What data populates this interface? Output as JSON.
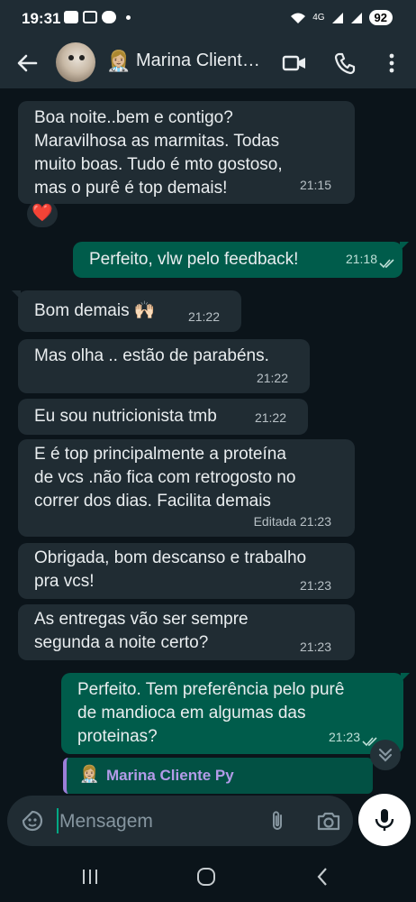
{
  "status_bar": {
    "time": "19:31",
    "network_label": "4G",
    "battery": "92"
  },
  "header": {
    "contact_name": "Marina Client…",
    "contact_emoji": "👩🏼‍⚕️"
  },
  "messages": [
    {
      "dir": "in",
      "text": "Boa noite..bem e contigo?\nMaravilhosa as marmitas. Todas\nmuito boas. Tudo é mto gostoso,\nmas o purê é top demais!",
      "time": "21:15"
    },
    {
      "dir": "out",
      "text": "Perfeito, vlw pelo feedback!",
      "time": "21:18"
    },
    {
      "dir": "in",
      "text": "Bom demais 🙌🏻",
      "time": "21:22"
    },
    {
      "dir": "in",
      "text": "Mas olha .. estão de parabéns.",
      "time": "21:22"
    },
    {
      "dir": "in",
      "text": "Eu sou nutricionista tmb",
      "time": "21:22"
    },
    {
      "dir": "in",
      "text": "E é top principalmente a proteína\nde vcs .não fica com retrogosto no\ncorrer dos dias. Facilita demais",
      "time": "Editada 21:23"
    },
    {
      "dir": "in",
      "text": "Obrigada, bom descanso e trabalho\npra vcs!",
      "time": "21:23"
    },
    {
      "dir": "in",
      "text": "As entregas vão ser sempre\nsegunda a noite certo?",
      "time": "21:23"
    },
    {
      "dir": "out",
      "text": "Perfeito. Tem preferência pelo purê\nde mandioca em algumas das\nproteinas?",
      "time": "21:23"
    }
  ],
  "reaction": {
    "emoji": "❤️"
  },
  "reply_preview": {
    "name": "Marina Cliente Py",
    "emoji": "👩🏼‍⚕️"
  },
  "composer": {
    "placeholder": "Mensagem"
  },
  "colors": {
    "background": "#0b141a",
    "incoming_bubble": "#202c33",
    "outgoing_bubble": "#005c4b",
    "header": "#1f2c34",
    "accent": "#00a884"
  },
  "icons": {
    "back": "arrow-left-icon",
    "video": "video-call-icon",
    "call": "phone-icon",
    "menu": "kebab-menu-icon",
    "sticker": "sticker-icon",
    "attach": "paperclip-icon",
    "camera": "camera-icon",
    "mic": "microphone-icon",
    "ticks": "double-check-icon",
    "scroll": "chevron-double-down-icon"
  }
}
